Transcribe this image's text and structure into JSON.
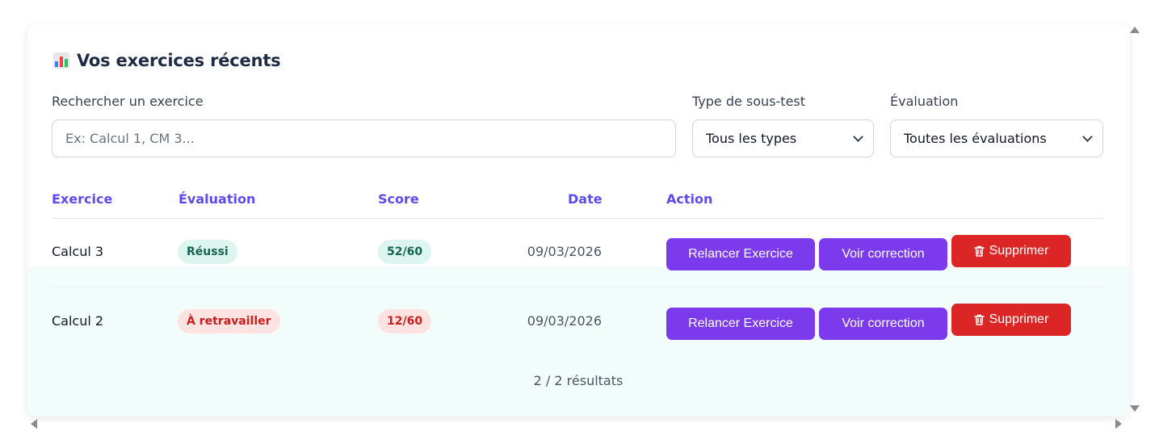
{
  "header": {
    "icon": "bar-chart-icon",
    "title": "Vos exercices récents"
  },
  "filters": {
    "search_label": "Rechercher un exercice",
    "search_placeholder": "Ex: Calcul 1, CM 3...",
    "type_label": "Type de sous-test",
    "type_value": "Tous les types",
    "eval_label": "Évaluation",
    "eval_value": "Toutes les évaluations"
  },
  "table": {
    "columns": [
      "Exercice",
      "Évaluation",
      "Score",
      "Date",
      "Action"
    ],
    "rows": [
      {
        "exercise": "Calcul 3",
        "evaluation": "Réussi",
        "evaluation_status": "success",
        "score": "52/60",
        "date": "09/03/2026",
        "actions": [
          "Relancer Exercice",
          "Voir correction",
          "Supprimer"
        ]
      },
      {
        "exercise": "Calcul 2",
        "evaluation": "À retravailler",
        "evaluation_status": "fail",
        "score": "12/60",
        "date": "09/03/2026",
        "actions": [
          "Relancer Exercice",
          "Voir correction",
          "Supprimer"
        ]
      }
    ]
  },
  "pagination": {
    "text": "2 / 2 résultats"
  },
  "colors": {
    "accent": "#5b4bf0",
    "button_purple": "#7c3aed",
    "button_red": "#dc2626",
    "success_bg": "#dcf5ee",
    "success_text": "#16634f",
    "fail_bg": "#fde2e2",
    "fail_text": "#c81e1e"
  }
}
